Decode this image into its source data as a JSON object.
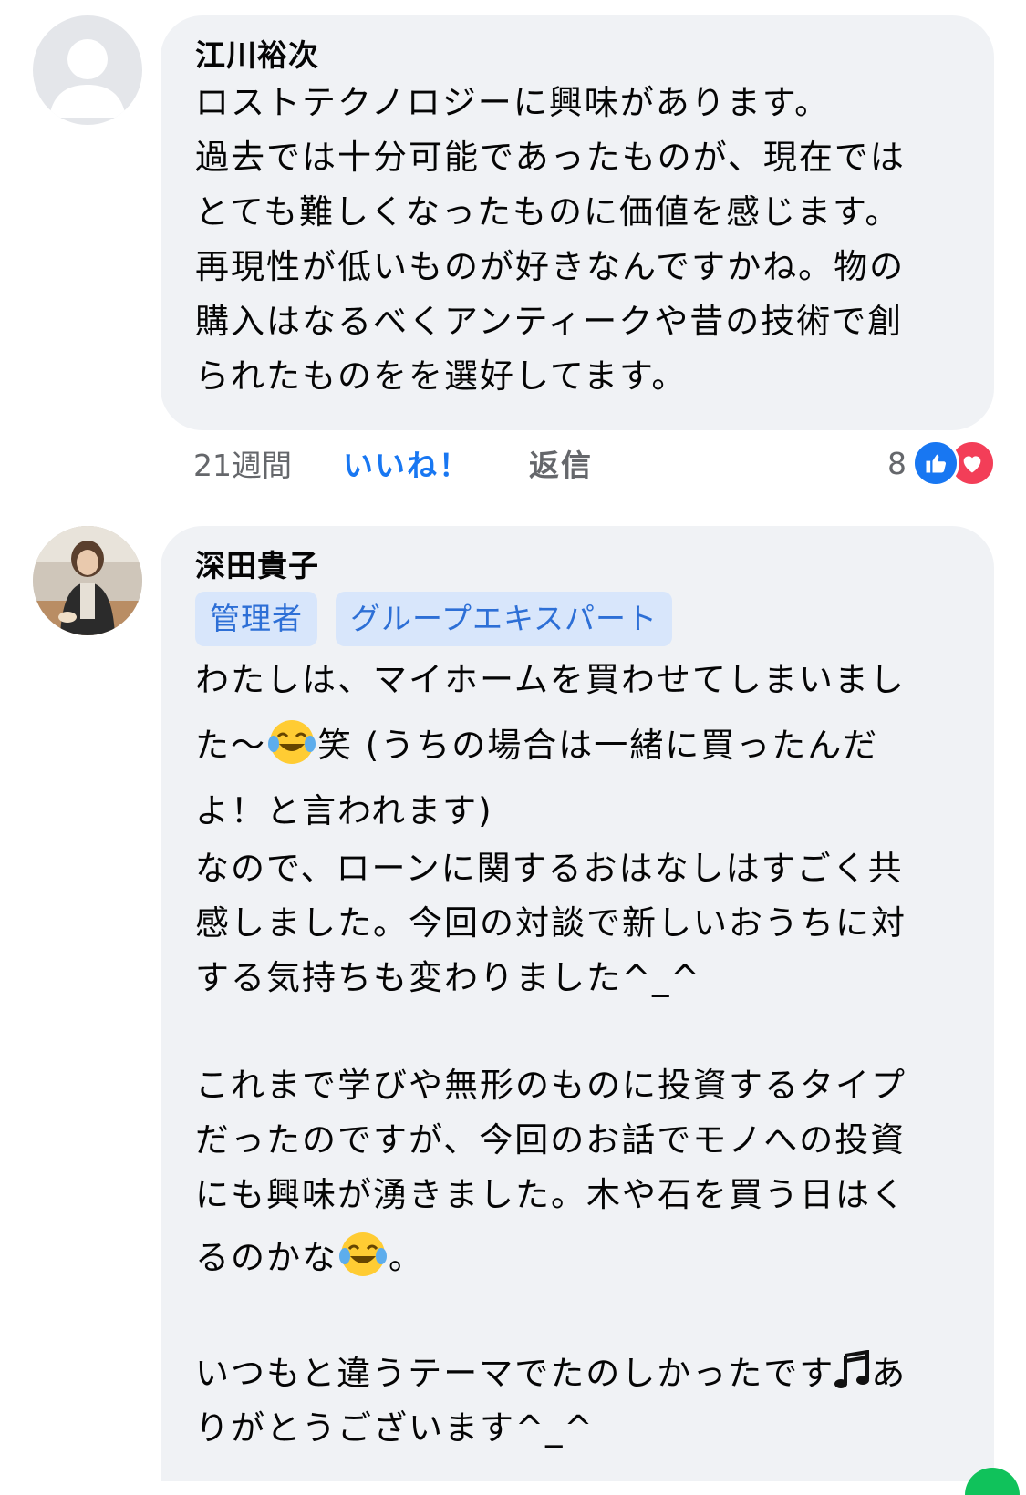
{
  "comments": [
    {
      "author": "江川裕次",
      "lines": [
        "ロストテクノロジーに興味があります。",
        "過去では十分可能であったものが、現在では",
        "とても難しくなったものに価値を感じます。",
        "再現性が低いものが好きなんですかね。物の",
        "購入はなるべくアンティークや昔の技術で創",
        "られたものをを選好してます。"
      ],
      "meta": {
        "time": "21週間",
        "like": "いいね！",
        "reply": "返信",
        "reaction_count": "8"
      }
    },
    {
      "author": "深田貴子",
      "badges": [
        "管理者",
        "グループエキスパート"
      ],
      "lines": [
        "わたしは、マイホームを買わせてしまいまし",
        "た〜",
        "笑 (うちの場合は一緒に買ったんだ",
        "よ！と言われます)",
        "なので、ローンに関するおはなしはすごく共",
        "感しました。今回の対談で新しいおうちに対",
        "する気持ちも変わりました^_^",
        "これまで学びや無形のものに投資するタイプ",
        "だったのですが、今回のお話でモノへの投資",
        "にも興味が湧きました。木や石を買う日はく",
        "るのかな",
        "。",
        "いつもと違うテーマでたのしかったです",
        "あ",
        "りがとうございます^_^"
      ]
    }
  ],
  "icons": {
    "default_avatar": "person-silhouette-icon",
    "like_reaction": "thumbs-up-icon",
    "love_reaction": "heart-icon",
    "laughing_emoji": "face-with-tears-of-joy-icon",
    "music_note": "music-note-icon"
  },
  "colors": {
    "bubble": "#f0f2f5",
    "link_blue": "#1877f2",
    "badge_bg": "#d8e6fb",
    "love_red": "#f33e58"
  }
}
